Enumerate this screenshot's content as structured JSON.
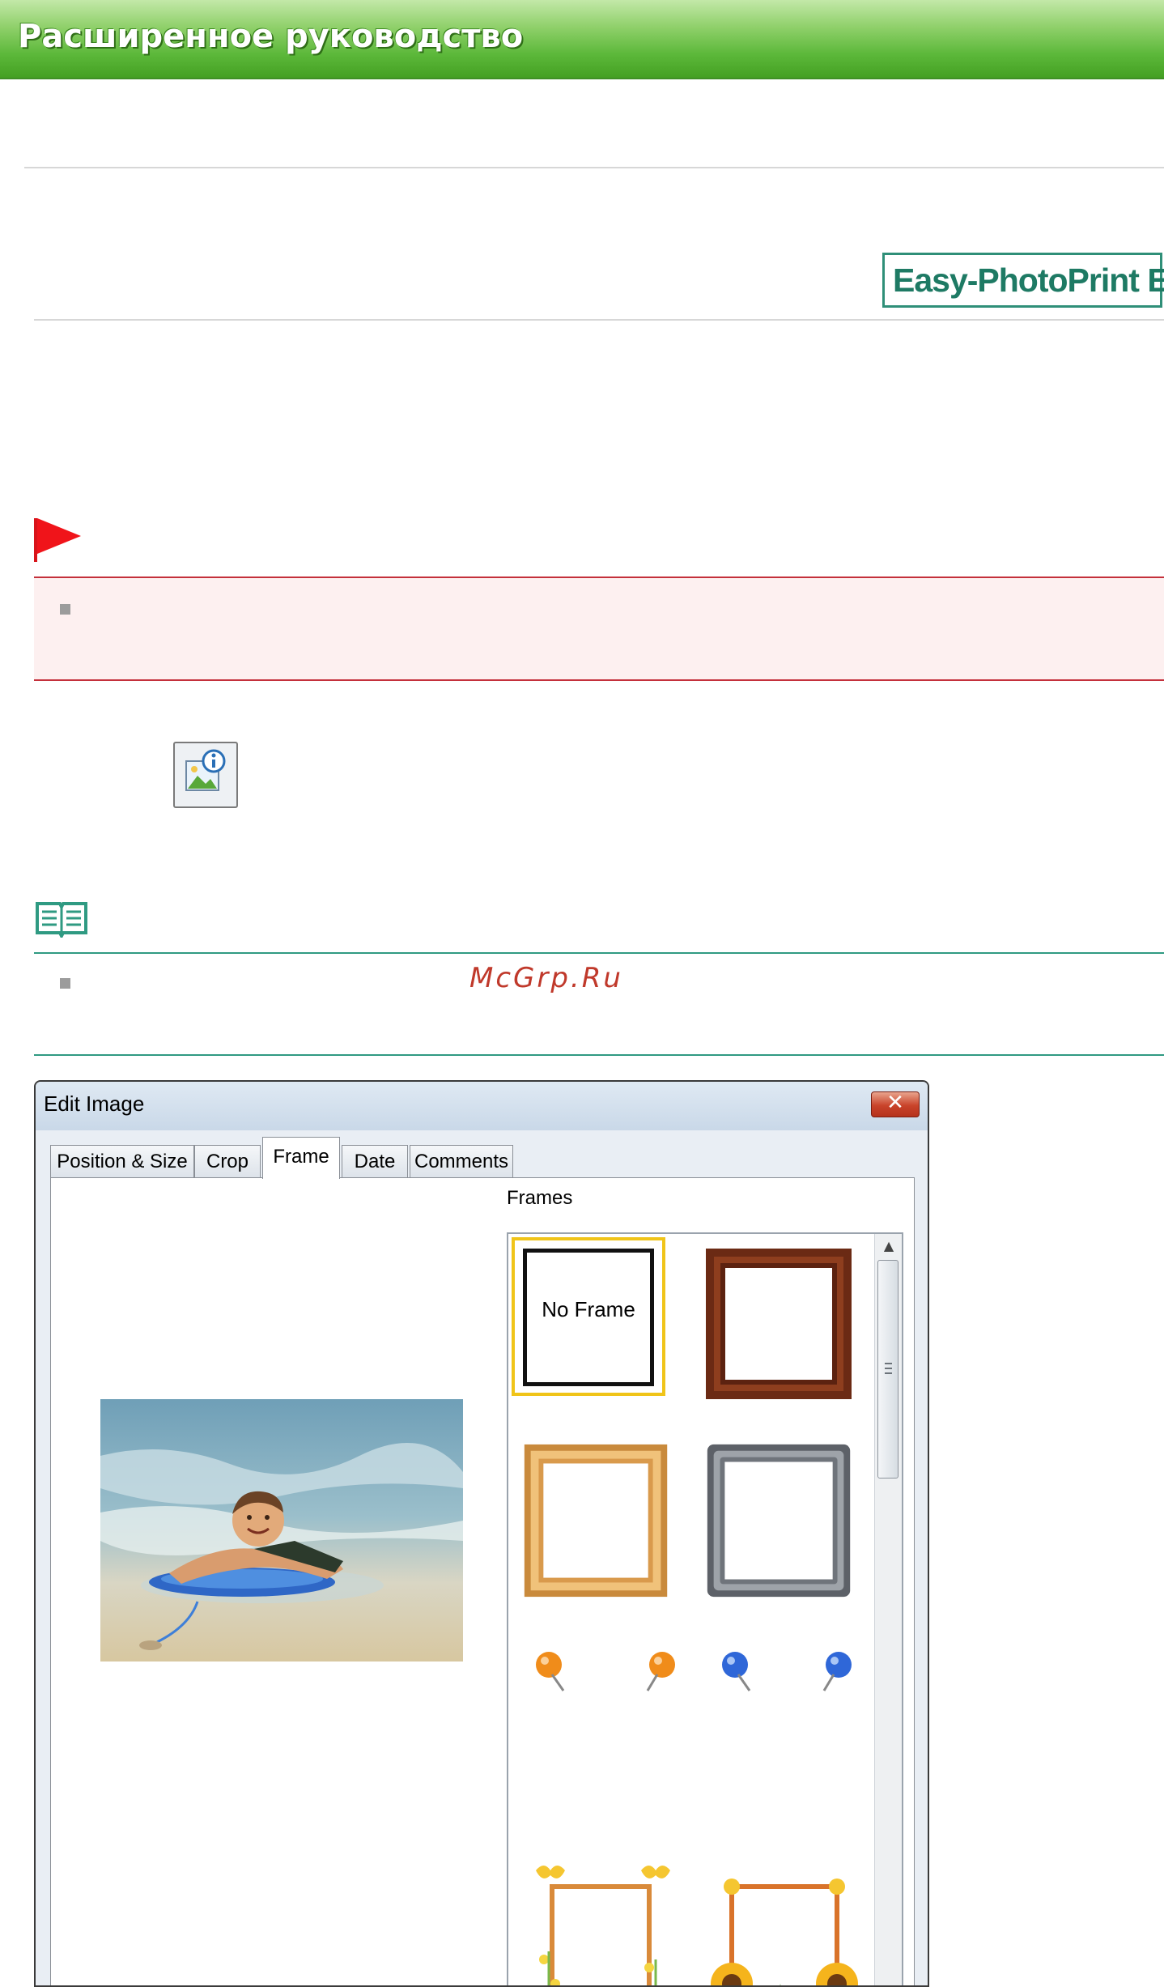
{
  "header": {
    "title": "Расширенное руководство"
  },
  "logo": {
    "text": "Easy-PhotoPrint EX"
  },
  "watermark": "McGrp.Ru",
  "dialog": {
    "title": "Edit Image",
    "close_label": "✕",
    "tabs": [
      {
        "label": "Position & Size"
      },
      {
        "label": "Crop"
      },
      {
        "label": "Frame",
        "active": true
      },
      {
        "label": "Date"
      },
      {
        "label": "Comments"
      }
    ],
    "frames_label": "Frames",
    "no_frame_label": "No Frame",
    "frame_options": [
      "no-frame",
      "dark-wood-frame",
      "light-wood-frame",
      "metal-frame",
      "push-pin-frame",
      "butterfly-flower-frame",
      "sunflower-frame"
    ]
  },
  "colors": {
    "banner": "#5cb83a",
    "important_border": "#c4303b",
    "note_border": "#2f9a82",
    "selection": "#f0c419"
  }
}
